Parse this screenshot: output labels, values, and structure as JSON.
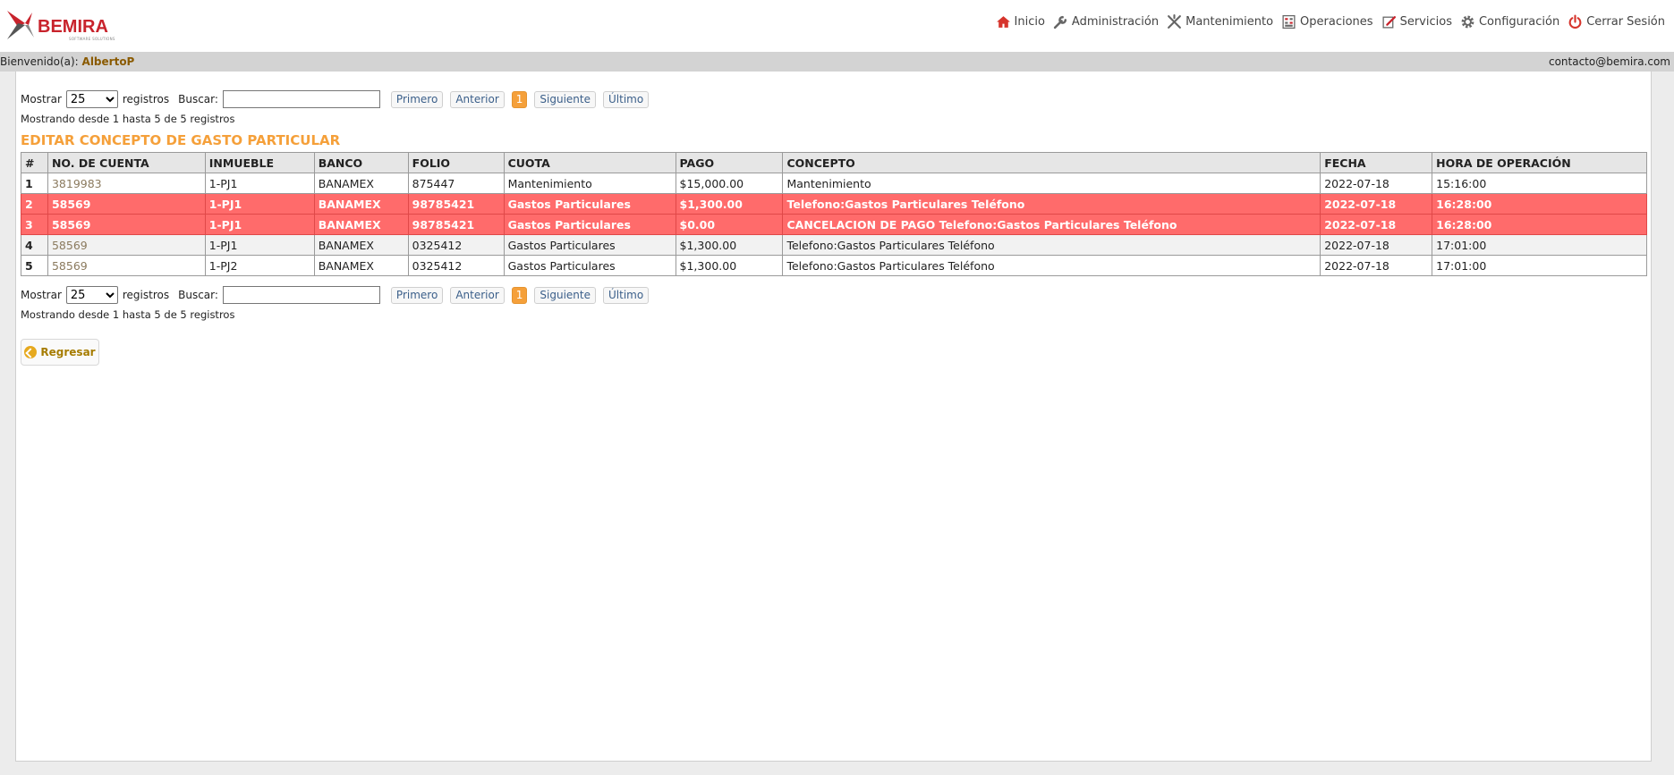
{
  "header": {
    "logo_text": "BEMIRA",
    "logo_subtext": "SOFTWARE SOLUTIONS",
    "nav": [
      {
        "label": "Inicio",
        "icon": "home-icon"
      },
      {
        "label": "Administración",
        "icon": "wrench-icon"
      },
      {
        "label": "Mantenimiento",
        "icon": "tools-icon"
      },
      {
        "label": "Operaciones",
        "icon": "calculator-icon"
      },
      {
        "label": "Servicios",
        "icon": "edit-icon"
      },
      {
        "label": "Configuración",
        "icon": "gear-icon"
      },
      {
        "label": "Cerrar Sesión",
        "icon": "power-icon"
      }
    ]
  },
  "welcome": {
    "prefix": "Bienvenido(a):",
    "user": "AlbertoP",
    "email": "contacto@bemira.com"
  },
  "controls": {
    "show_label": "Mostrar",
    "show_value": "25",
    "records_label": "registros",
    "search_label": "Buscar:",
    "search_value": "",
    "first": "Primero",
    "prev": "Anterior",
    "page": "1",
    "next": "Siguiente",
    "last": "Último",
    "info": "Mostrando desde 1 hasta 5 de 5 registros"
  },
  "title": "EDITAR CONCEPTO DE GASTO PARTICULAR",
  "table": {
    "headers": [
      "#",
      "NO. DE CUENTA",
      "INMUEBLE",
      "BANCO",
      "FOLIO",
      "CUOTA",
      "PAGO",
      "CONCEPTO",
      "FECHA",
      "HORA DE OPERACIÓN"
    ],
    "rows": [
      [
        "1",
        "3819983",
        "1-PJ1",
        "BANAMEX",
        "875447",
        "Mantenimiento",
        "$15,000.00",
        "Mantenimiento",
        "2022-07-18",
        "15:16:00"
      ],
      [
        "2",
        "58569",
        "1-PJ1",
        "BANAMEX",
        "98785421",
        "Gastos Particulares",
        "$1,300.00",
        "Telefono:Gastos Particulares Teléfono",
        "2022-07-18",
        "16:28:00"
      ],
      [
        "3",
        "58569",
        "1-PJ1",
        "BANAMEX",
        "98785421",
        "Gastos Particulares",
        "$0.00",
        "CANCELACION DE PAGO Telefono:Gastos Particulares Teléfono",
        "2022-07-18",
        "16:28:00"
      ],
      [
        "4",
        "58569",
        "1-PJ1",
        "BANAMEX",
        "0325412",
        "Gastos Particulares",
        "$1,300.00",
        "Telefono:Gastos Particulares Teléfono",
        "2022-07-18",
        "17:01:00"
      ],
      [
        "5",
        "58569",
        "1-PJ2",
        "BANAMEX",
        "0325412",
        "Gastos Particulares",
        "$1,300.00",
        "Telefono:Gastos Particulares Teléfono",
        "2022-07-18",
        "17:01:00"
      ]
    ]
  },
  "back_label": "Regresar",
  "colors": {
    "accent": "#f5a03a",
    "highlight_row": "#ff6b6b",
    "brand": "#c8232c"
  }
}
